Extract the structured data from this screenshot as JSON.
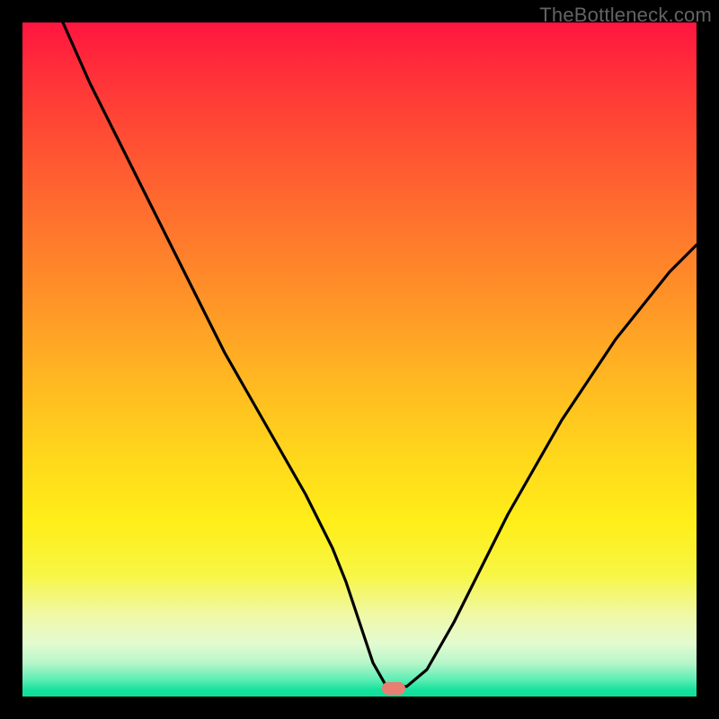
{
  "watermark": "TheBottleneck.com",
  "chart_data": {
    "type": "line",
    "title": "",
    "xlabel": "",
    "ylabel": "",
    "xlim": [
      0,
      100
    ],
    "ylim": [
      0,
      100
    ],
    "grid": false,
    "series": [
      {
        "name": "bottleneck-curve",
        "x": [
          6,
          10,
          14,
          18,
          22,
          26,
          30,
          34,
          38,
          42,
          46,
          48,
          50,
          52,
          54,
          55,
          57,
          60,
          64,
          68,
          72,
          76,
          80,
          84,
          88,
          92,
          96,
          100
        ],
        "values": [
          100,
          91,
          83,
          75,
          67,
          59,
          51,
          44,
          37,
          30,
          22,
          17,
          11,
          5,
          1.5,
          1.5,
          1.5,
          4,
          11,
          19,
          27,
          34,
          41,
          47,
          53,
          58,
          63,
          67
        ]
      }
    ],
    "marker": {
      "x": 55,
      "y": 1.2,
      "color": "#e87f72"
    },
    "gradient_stops": [
      {
        "pos": 0,
        "color": "#ff1540"
      },
      {
        "pos": 0.5,
        "color": "#ffd61c"
      },
      {
        "pos": 0.85,
        "color": "#f7f646"
      },
      {
        "pos": 1.0,
        "color": "#10df98"
      }
    ]
  }
}
